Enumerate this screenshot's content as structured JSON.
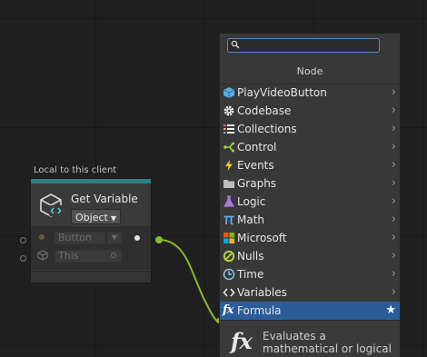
{
  "canvas": {
    "group_label": "Local to this client"
  },
  "node": {
    "title": "Get Variable",
    "kind_select": "Object",
    "inputs": [
      {
        "value": "Button",
        "icon": "circle-port"
      },
      {
        "value": "This",
        "icon": "cube-icon"
      }
    ],
    "accent_color": "#2e7f82"
  },
  "fuzzy_finder": {
    "search": {
      "value": "",
      "placeholder": ""
    },
    "title": "Node",
    "items": [
      {
        "label": "PlayVideoButton",
        "icon": "cube-blue-icon",
        "submenu": true
      },
      {
        "label": "Codebase",
        "icon": "gear-icon",
        "submenu": true
      },
      {
        "label": "Collections",
        "icon": "list-icon",
        "submenu": true
      },
      {
        "label": "Control",
        "icon": "branch-icon",
        "submenu": true
      },
      {
        "label": "Events",
        "icon": "lightning-icon",
        "submenu": true
      },
      {
        "label": "Graphs",
        "icon": "folder-icon",
        "submenu": true
      },
      {
        "label": "Logic",
        "icon": "flask-icon",
        "submenu": true
      },
      {
        "label": "Math",
        "icon": "pi-icon",
        "submenu": true
      },
      {
        "label": "Microsoft",
        "icon": "windows-icon",
        "submenu": true
      },
      {
        "label": "Nulls",
        "icon": "null-icon",
        "submenu": true
      },
      {
        "label": "Time",
        "icon": "clock-icon",
        "submenu": true
      },
      {
        "label": "Variables",
        "icon": "code-icon",
        "submenu": true
      },
      {
        "label": "Formula",
        "icon": "fx-icon",
        "selected": true,
        "favorite": true
      }
    ],
    "description": {
      "icon": "fx-icon",
      "text": "Evaluates a mathematical or logical"
    },
    "selection_color": "#2c5d9b"
  }
}
